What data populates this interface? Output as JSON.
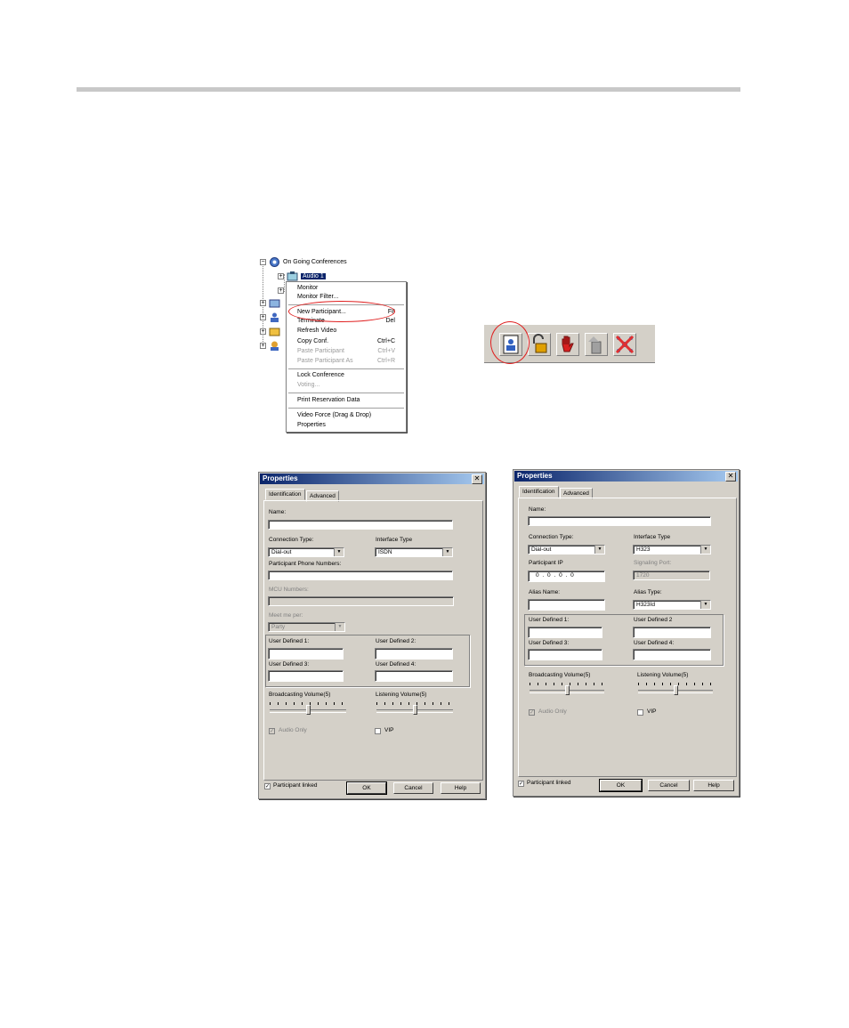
{
  "tree": {
    "root_label": "On Going Conferences",
    "selected_item": "Audio 1"
  },
  "context_menu": {
    "items": [
      {
        "label": "Monitor",
        "shortcut": "",
        "disabled": false
      },
      {
        "label": "Monitor Filter...",
        "shortcut": "",
        "disabled": false
      },
      {
        "label": "New Participant...",
        "shortcut": "F8",
        "disabled": false
      },
      {
        "label": "Terminate",
        "shortcut": "Del",
        "disabled": false
      },
      {
        "label": "Refresh Video",
        "shortcut": "",
        "disabled": false
      },
      {
        "label": "Copy Conf.",
        "shortcut": "Ctrl+C",
        "disabled": false
      },
      {
        "label": "Paste Participant",
        "shortcut": "Ctrl+V",
        "disabled": true
      },
      {
        "label": "Paste Participant As",
        "shortcut": "Ctrl+R",
        "disabled": true
      },
      {
        "label": "Lock Conference",
        "shortcut": "",
        "disabled": false
      },
      {
        "label": "Voting...",
        "shortcut": "",
        "disabled": true
      },
      {
        "label": "Print Reservation Data",
        "shortcut": "",
        "disabled": false
      },
      {
        "label": "Video Force (Drag & Drop)",
        "shortcut": "",
        "disabled": false
      },
      {
        "label": "Properties",
        "shortcut": "",
        "disabled": false
      }
    ]
  },
  "toolbar": {
    "icons": [
      "new-participant-icon",
      "unlock-icon",
      "stop-hand-icon",
      "terminate-icon",
      "disconnect-icon"
    ],
    "colors": {
      "hand": "#d82020",
      "lock": "#e0a000",
      "person": "#3060c0",
      "x": "#e03030"
    }
  },
  "dialog_isdn": {
    "title": "Properties",
    "tabs": [
      "Identification",
      "Advanced"
    ],
    "name_label": "Name:",
    "name_value": "",
    "connection_type_label": "Connection Type:",
    "connection_type_value": "Dial-out",
    "interface_type_label": "Interface Type",
    "interface_type_value": "ISDN",
    "phone_label": "Participant Phone Numbers:",
    "mcu_label": "MCU Numbers:",
    "meet_label": "Meet me per:",
    "meet_value": "Party",
    "ud1": "User Defined 1:",
    "ud2": "User Defined 2:",
    "ud3": "User Defined 3:",
    "ud4": "User Defined 4:",
    "bcast": "Broadcasting Volume(5)",
    "listen": "Listening Volume(5)",
    "bcast_level": 5,
    "listen_level": 5,
    "audio_only": "Audio Only",
    "vip": "VIP",
    "linked": "Participant linked",
    "ok": "OK",
    "cancel": "Cancel",
    "help": "Help"
  },
  "dialog_h323": {
    "title": "Properties",
    "tabs": [
      "Identification",
      "Advanced"
    ],
    "name_label": "Name:",
    "name_value": "",
    "connection_type_label": "Connection Type:",
    "connection_type_value": "Dial-out",
    "interface_type_label": "Interface Type",
    "interface_type_value": "H323",
    "ip_label": "Participant IP",
    "ip_value": "0 . 0 . 0 . 0",
    "port_label": "Signaling Port:",
    "port_value": "1720",
    "alias_label": "Alias Name:",
    "alias_type_label": "Alias Type:",
    "alias_type_value": "H323Id",
    "ud1": "User Defined 1:",
    "ud2": "User Defined 2",
    "ud3": "User Defined 3:",
    "ud4": "User Defined 4:",
    "bcast": "Broadcasting Volume(5)",
    "listen": "Listening Volume(5)",
    "bcast_level": 5,
    "listen_level": 5,
    "audio_only": "Audio Only",
    "vip": "VIP",
    "linked": "Participant linked",
    "ok": "OK",
    "cancel": "Cancel",
    "help": "Help"
  }
}
